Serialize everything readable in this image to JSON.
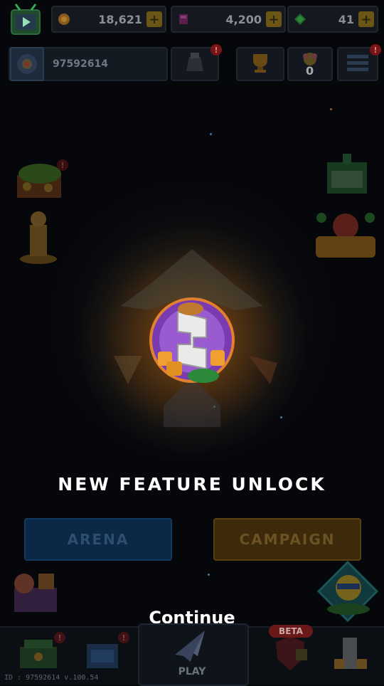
{
  "currency": {
    "coins": "18,621",
    "energy": "4,200",
    "gems": "41",
    "plus": "+"
  },
  "profile": {
    "player_id": "97592614",
    "mail_count": "0"
  },
  "feature": {
    "title": "NEW FEATURE UNLOCK"
  },
  "modes": {
    "arena": "ARENA",
    "campaign": "CAMPAIGN"
  },
  "continue_label": "Continue",
  "bottom_nav": {
    "play_label": "PLAY",
    "beta_label": "BETA",
    "version": "ID : 97592614 v.100.54"
  },
  "colors": {
    "accent_gold": "#f3b23a",
    "arena_blue": "#0b2846",
    "campaign_orange": "#3c2a0a"
  },
  "icons": [
    "tv-icon",
    "coin-icon",
    "energy-icon",
    "gem-icon",
    "trophy-icon",
    "helmet-icon",
    "mail-icon",
    "menu-icon",
    "chest-icon",
    "statue-icon",
    "gift-icon",
    "falcon-tycoon-icon",
    "lucky-box-icon",
    "duck-pack-icon",
    "shop-icon",
    "hangar-icon",
    "play-ship-icon",
    "beta-shield-icon",
    "tower-icon",
    "feature-emblem-icon"
  ]
}
